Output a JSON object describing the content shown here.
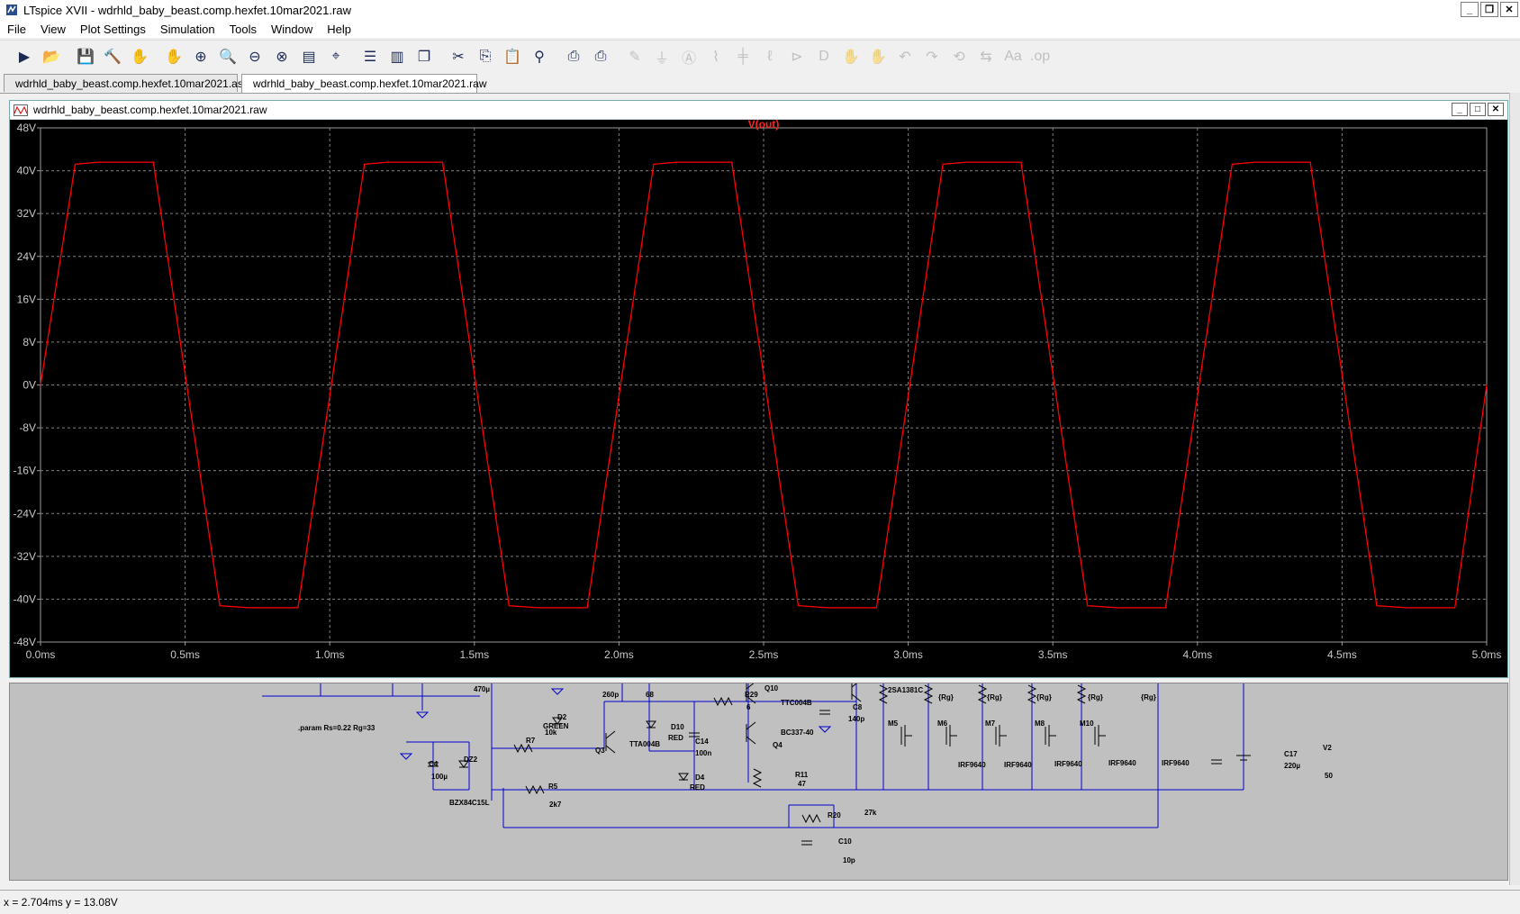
{
  "window": {
    "title": "LTspice XVII - wdrhld_baby_beast.comp.hexfet.10mar2021.raw",
    "minimize": "_",
    "restore": "❐",
    "close": "✕"
  },
  "menu": [
    "File",
    "View",
    "Plot Settings",
    "Simulation",
    "Tools",
    "Window",
    "Help"
  ],
  "toolbar": {
    "icons": [
      "run-icon",
      "open-icon",
      "save-icon",
      "control-panel-icon",
      "halt-icon",
      "pan-hand-icon",
      "zoom-in-icon",
      "zoom-area-icon",
      "zoom-out-icon",
      "zoom-fit-icon",
      "autorange-icon",
      "cursor-icon",
      "tile-horizontal-icon",
      "tile-vertical-icon",
      "cascade-icon",
      "cut-icon",
      "copy-icon",
      "paste-icon",
      "find-icon",
      "print-icon",
      "print-setup-icon",
      "wire-icon",
      "ground-icon",
      "label-icon",
      "resistor-icon",
      "capacitor-icon",
      "inductor-icon",
      "diode-icon",
      "component-icon",
      "move-icon",
      "drag-icon",
      "undo-icon",
      "redo-icon",
      "rotate-icon",
      "mirror-icon",
      "text-icon",
      "spice-directive-icon"
    ],
    "disabled_from": 21
  },
  "tabs": [
    {
      "label": "wdrhld_baby_beast.comp.hexfet.10mar2021.asc",
      "active": false
    },
    {
      "label": "wdrhld_baby_beast.comp.hexfet.10mar2021.raw",
      "active": true
    }
  ],
  "plot_window": {
    "title": "wdrhld_baby_beast.comp.hexfet.10mar2021.raw"
  },
  "chart_data": {
    "type": "line",
    "title": "V(out)",
    "xlabel": "",
    "ylabel": "",
    "xlim": [
      0,
      5.0
    ],
    "ylim": [
      -48,
      48
    ],
    "xticks": [
      "0.0ms",
      "0.5ms",
      "1.0ms",
      "1.5ms",
      "2.0ms",
      "2.5ms",
      "3.0ms",
      "3.5ms",
      "4.0ms",
      "4.5ms",
      "5.0ms"
    ],
    "yticks": [
      "48V",
      "40V",
      "32V",
      "24V",
      "16V",
      "8V",
      "0V",
      "-8V",
      "-16V",
      "-24V",
      "-32V",
      "-40V",
      "-48V"
    ],
    "grid": true,
    "series": [
      {
        "name": "V(out)",
        "color": "#ff0000",
        "x": [
          0,
          0.12,
          0.2,
          0.39,
          0.62,
          0.72,
          0.89,
          1.12,
          1.2,
          1.39,
          1.62,
          1.72,
          1.89,
          2.12,
          2.2,
          2.39,
          2.62,
          2.72,
          2.89,
          3.12,
          3.2,
          3.39,
          3.62,
          3.72,
          3.89,
          4.12,
          4.2,
          4.39,
          4.62,
          4.72,
          4.89,
          5.0
        ],
        "y": [
          0,
          41.2,
          41.6,
          41.6,
          -41.2,
          -41.6,
          -41.6,
          41.2,
          41.6,
          41.6,
          -41.2,
          -41.6,
          -41.6,
          41.2,
          41.6,
          41.6,
          -41.2,
          -41.6,
          -41.6,
          41.2,
          41.6,
          41.6,
          -41.2,
          -41.6,
          -41.6,
          41.2,
          41.6,
          41.6,
          -41.2,
          -41.6,
          -41.6,
          0
        ]
      }
    ]
  },
  "schematic": {
    "labels": [
      {
        "name": "param-directive",
        "text": ".param Rs=0.22 Rg=33"
      },
      {
        "name": "c4-label",
        "text": "C4"
      },
      {
        "name": "c4-value",
        "text": "100µ"
      },
      {
        "name": "dz2-label",
        "text": "DZ2"
      },
      {
        "name": "dz2-value",
        "text": "BZX84C15L"
      },
      {
        "name": "cap-470-value",
        "text": "470µ"
      },
      {
        "name": "r7-label",
        "text": "R7"
      },
      {
        "name": "d2-label",
        "text": "D2"
      },
      {
        "name": "d2-value",
        "text": "GREEN"
      },
      {
        "name": "r-10k-value",
        "text": "10k"
      },
      {
        "name": "c-260p-value",
        "text": "260p"
      },
      {
        "name": "r-68-value",
        "text": "68"
      },
      {
        "name": "q3-label",
        "text": "Q3"
      },
      {
        "name": "q3-value",
        "text": "TTA004B"
      },
      {
        "name": "d10-label",
        "text": "D10"
      },
      {
        "name": "d10-value",
        "text": "RED"
      },
      {
        "name": "c14-label",
        "text": "C14"
      },
      {
        "name": "c14-value",
        "text": "100n"
      },
      {
        "name": "d4-label",
        "text": "D4"
      },
      {
        "name": "d4-value",
        "text": "RED"
      },
      {
        "name": "r5-label",
        "text": "R5"
      },
      {
        "name": "r5-value",
        "text": "2k7"
      },
      {
        "name": "r29-label",
        "text": "R29"
      },
      {
        "name": "r29-value",
        "text": "6"
      },
      {
        "name": "q10-label",
        "text": "Q10"
      },
      {
        "name": "q10-value",
        "text": "TTC004B"
      },
      {
        "name": "q4-label",
        "text": "Q4"
      },
      {
        "name": "q4-value",
        "text": "BC337-40"
      },
      {
        "name": "r11-label",
        "text": "R11"
      },
      {
        "name": "r11-value",
        "text": "47"
      },
      {
        "name": "c8-label",
        "text": "C8"
      },
      {
        "name": "c8-value",
        "text": "140p"
      },
      {
        "name": "q-2sa1381-value",
        "text": "2SA1381C"
      },
      {
        "name": "m5-label",
        "text": "M5"
      },
      {
        "name": "m6-label",
        "text": "M6"
      },
      {
        "name": "m7-label",
        "text": "M7"
      },
      {
        "name": "m8-label",
        "text": "M8"
      },
      {
        "name": "m10-label",
        "text": "M10"
      },
      {
        "name": "irf-1",
        "text": "IRF9640"
      },
      {
        "name": "irf-2",
        "text": "IRF9640"
      },
      {
        "name": "irf-3",
        "text": "IRF9640"
      },
      {
        "name": "irf-4",
        "text": "IRF9640"
      },
      {
        "name": "irf-5",
        "text": "IRF9640"
      },
      {
        "name": "rg-1",
        "text": "{Rg}"
      },
      {
        "name": "rg-2",
        "text": "{Rg}"
      },
      {
        "name": "rg-3",
        "text": "{Rg}"
      },
      {
        "name": "rg-4",
        "text": "{Rg}"
      },
      {
        "name": "rg-5",
        "text": "{Rg}"
      },
      {
        "name": "r20-label",
        "text": "R20"
      },
      {
        "name": "r20-value",
        "text": "27k"
      },
      {
        "name": "c10-label",
        "text": "C10"
      },
      {
        "name": "c10-value",
        "text": "10p"
      },
      {
        "name": "c17-label",
        "text": "C17"
      },
      {
        "name": "c17-value",
        "text": "220µ"
      },
      {
        "name": "v2-label",
        "text": "V2"
      },
      {
        "name": "v2-value",
        "text": "50"
      }
    ]
  },
  "status": {
    "text": "x = 2.704ms    y = 13.08V"
  }
}
